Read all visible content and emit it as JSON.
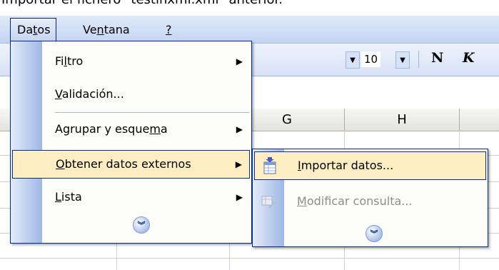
{
  "caption": "Importar el fichero \"testinxml.xml\" anterior.",
  "menubar": {
    "items": [
      "Datos",
      "Ventana",
      "?"
    ]
  },
  "toolbar": {
    "font_size": "10",
    "bold_label": "N",
    "italic_label": "K"
  },
  "grid": {
    "column_headers": [
      "G",
      "H"
    ]
  },
  "datos_menu": {
    "items": [
      {
        "label": "Filtro",
        "has_submenu": true
      },
      {
        "label": "Validación...",
        "has_submenu": false
      },
      {
        "label": "Agrupar y esquema",
        "has_submenu": true
      },
      {
        "label": "Obtener datos externos",
        "has_submenu": true,
        "highlighted": true
      },
      {
        "label": "Lista",
        "has_submenu": true
      }
    ],
    "expand_icon": "chevron-double-down-icon"
  },
  "submenu": {
    "items": [
      {
        "label": "Importar datos...",
        "icon": "import-data-icon",
        "highlighted": true,
        "enabled": true
      },
      {
        "label": "Modificar consulta...",
        "icon": "edit-query-icon",
        "enabled": false
      }
    ],
    "expand_icon": "chevron-double-down-icon"
  },
  "colors": {
    "menu_border": "#002d96",
    "highlight": "#ffeec2",
    "gutter": "#9fb8e6"
  }
}
